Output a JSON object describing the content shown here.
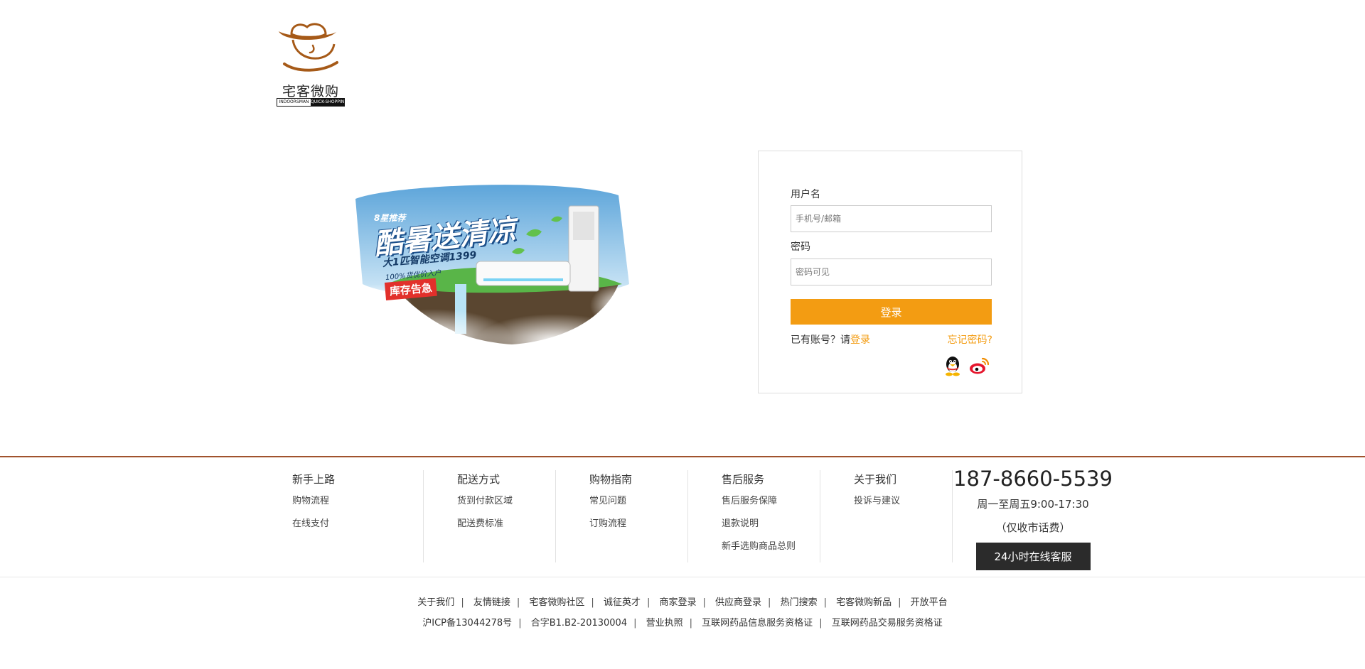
{
  "logo": {
    "cn": "宅客微购",
    "en_left": "INDOORSMAN",
    "en_right": "QUICK-SHOPPING"
  },
  "banner": {
    "badge": "8星推荐",
    "title": "酷暑送清凉",
    "subtitle": "大1匹智能空调1399",
    "note": "100%货优价入户",
    "tag": "库存告急"
  },
  "login": {
    "username_label": "用户名",
    "username_placeholder": "手机号/邮箱",
    "password_label": "密码",
    "password_placeholder": "密码可见",
    "submit_label": "登录",
    "have_account_text": "已有账号？请",
    "have_account_link": "登录",
    "forgot_label": "忘记密码?",
    "social": [
      "qq-icon",
      "weibo-icon"
    ]
  },
  "footer": {
    "columns": [
      {
        "title": "新手上路",
        "items": [
          "购物流程",
          "在线支付"
        ]
      },
      {
        "title": "配送方式",
        "items": [
          "货到付款区域",
          "配送费标准"
        ]
      },
      {
        "title": "购物指南",
        "items": [
          "常见问题",
          "订购流程"
        ]
      },
      {
        "title": "售后服务",
        "items": [
          "售后服务保障",
          "退款说明",
          "新手选购商品总则"
        ]
      },
      {
        "title": "关于我们",
        "items": [
          "投诉与建议"
        ]
      }
    ],
    "hotline": {
      "phone": "187-8660-5539",
      "hours": "周一至周五9:00-17:30",
      "note": "（仅收市话费）",
      "service_button": "24小时在线客服"
    },
    "links": [
      "关于我们",
      "友情链接",
      "宅客微购社区",
      "诚征英才",
      "商家登录",
      "供应商登录",
      "热门搜索",
      "宅客微购新品",
      "开放平台"
    ],
    "licenses": [
      "沪ICP备13044278号",
      "合字B1.B2-20130004",
      "营业执照",
      "互联网药品信息服务资格证",
      "互联网药品交易服务资格证"
    ],
    "colors": {
      "divider": "#a0522d",
      "accent": "#f39c12",
      "service_bg": "#2b2b2b"
    }
  }
}
